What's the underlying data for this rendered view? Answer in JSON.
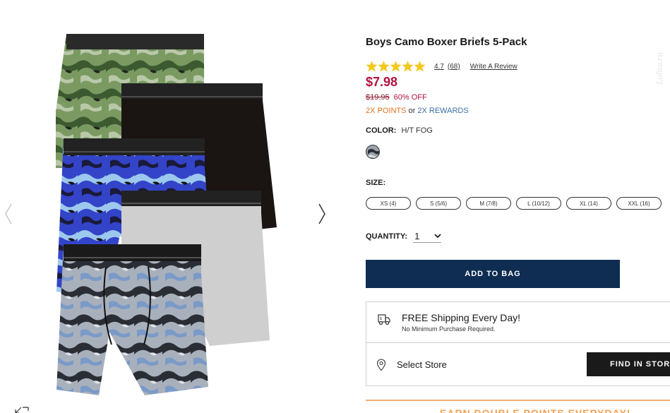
{
  "product": {
    "title": "Boys Camo Boxer Briefs 5-Pack",
    "rating": "4.7",
    "rating_count": "(68)",
    "write_review": "Write A Review",
    "price": "$7.98",
    "was_price": "$19.95",
    "discount": "60% OFF",
    "points": "2X POINTS",
    "or": "or",
    "rewards": "2X REWARDS"
  },
  "color": {
    "label": "COLOR:",
    "value": "H/T FOG"
  },
  "size": {
    "label": "SIZE:",
    "options": [
      "XS (4)",
      "S (5/6)",
      "M (7/8)",
      "L (10/12)",
      "XL (14)",
      "XXL (16)"
    ]
  },
  "quantity": {
    "label": "QUANTITY:",
    "value": "1"
  },
  "actions": {
    "add_to_bag": "ADD TO BAG",
    "find_in_store": "FIND IN STORE"
  },
  "shipping": {
    "title": "FREE Shipping Every Day!",
    "subtitle": "No Minimum Purchase Required.",
    "select_store": "Select Store"
  },
  "promo": {
    "text": "EARN DOUBLE POINTS EVERYDAY!"
  },
  "icons": {
    "star": "star-icon",
    "truck": "truck-icon",
    "pin": "location-pin-icon",
    "chevron": "chevron-down-icon",
    "expand": "expand-icon"
  },
  "colors": {
    "price_red": "#b3123f",
    "points_orange": "#e0721f",
    "rewards_blue": "#3a6fa8",
    "add_bag_navy": "#0f2d52",
    "star_gold": "#f2c81b"
  }
}
